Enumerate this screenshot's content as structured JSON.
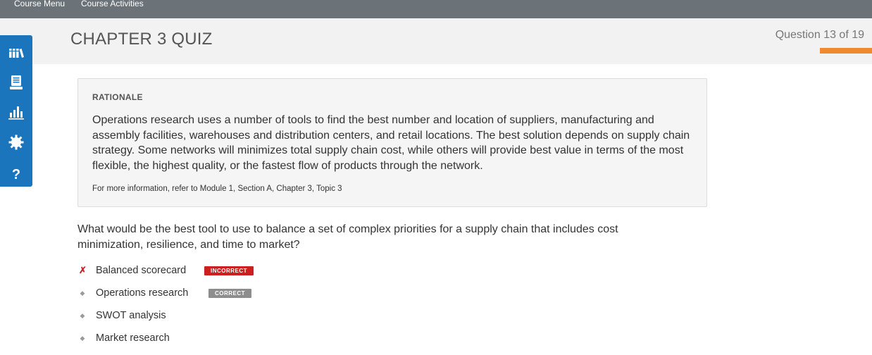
{
  "topnav": {
    "course_menu": "Course Menu",
    "course_activities": "Course Activities"
  },
  "header": {
    "title": "CHAPTER 3 QUIZ",
    "question_counter": "Question 13 of 19"
  },
  "sidebar": {
    "items": [
      {
        "icon": "library-icon"
      },
      {
        "icon": "notebook-icon"
      },
      {
        "icon": "bar-chart-icon"
      },
      {
        "icon": "gear-icon"
      },
      {
        "icon": "help-icon",
        "label": "?"
      }
    ]
  },
  "rationale": {
    "title": "RATIONALE",
    "body": "Operations research uses a number of tools to find the best number and location of suppliers, manufacturing and assembly facilities, warehouses and distribution centers, and retail locations. The best solution depends on supply chain strategy. Some networks will minimizes total supply chain cost, while others will provide best value in terms of the most flexible, the highest quality, or the fastest flow of products through the network.",
    "reference": "For more information, refer to Module 1, Section A, Chapter 3, Topic 3"
  },
  "question": {
    "text": "What would be the best tool to use to balance a set of complex priorities for a supply chain that includes cost minimization, resilience, and time to market?",
    "answers": [
      {
        "label": "Balanced scorecard",
        "mark": "✗",
        "badge": "INCORRECT"
      },
      {
        "label": "Operations research",
        "mark": "◆",
        "badge": "CORRECT"
      },
      {
        "label": "SWOT analysis",
        "mark": "◆"
      },
      {
        "label": "Market research",
        "mark": "◆"
      }
    ]
  },
  "colors": {
    "sidebar": "#1b75bc",
    "progress": "#ef8a2f",
    "incorrect": "#cc1f1f",
    "correct": "#8d8d8d",
    "topbar": "#6b7278"
  }
}
